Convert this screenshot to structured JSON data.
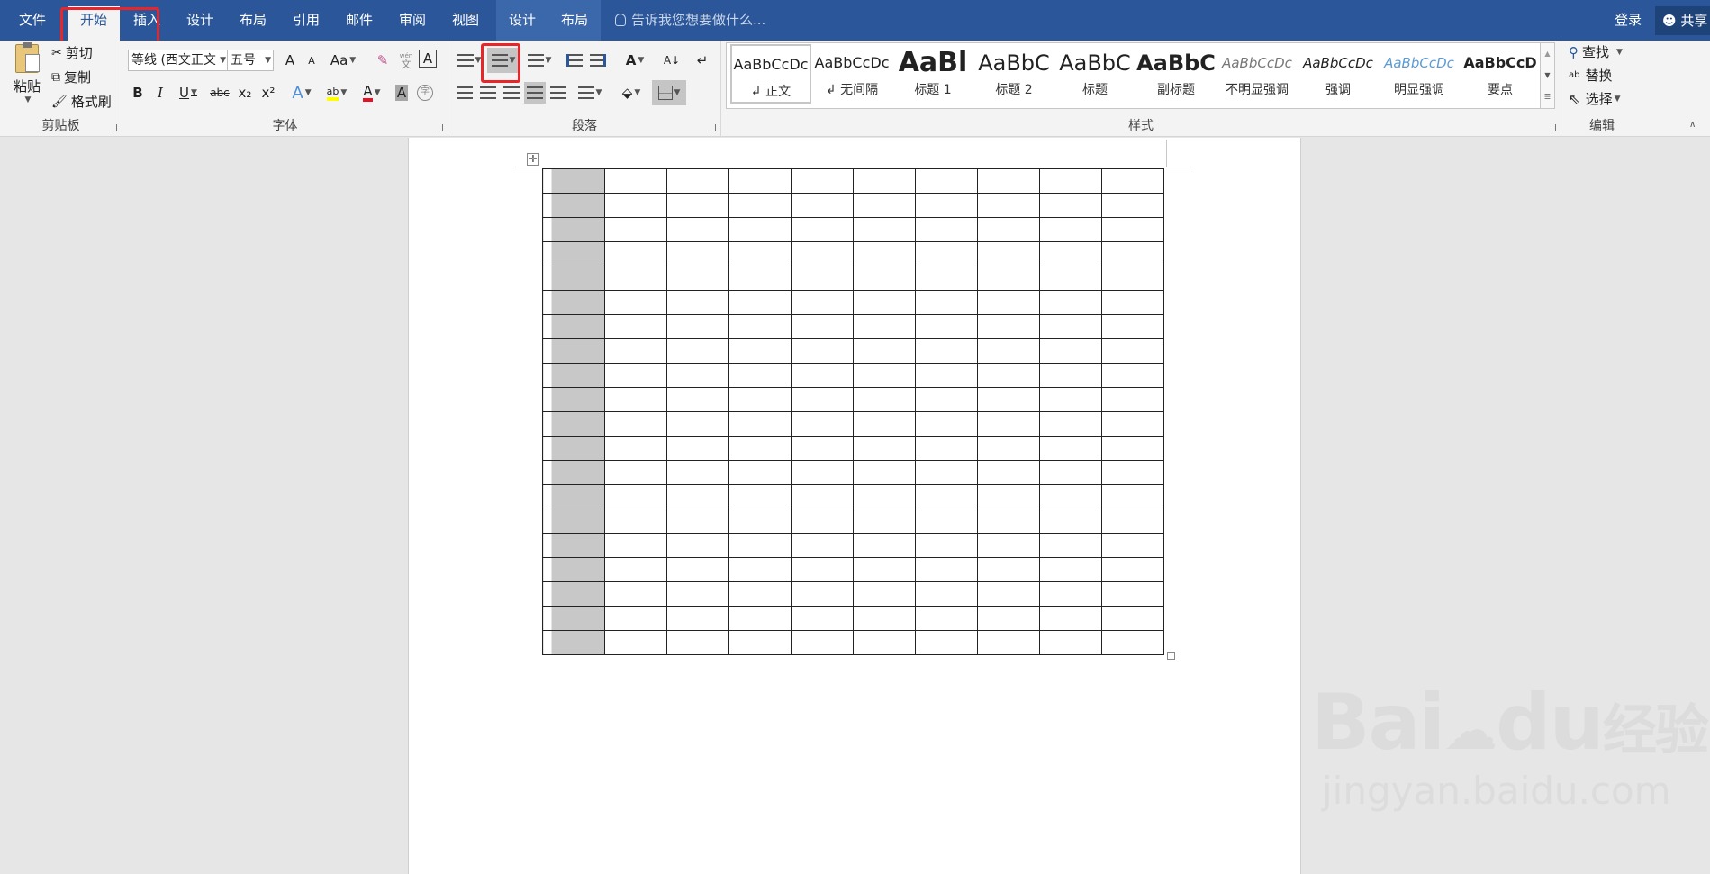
{
  "tabs": [
    "文件",
    "开始",
    "插入",
    "设计",
    "布局",
    "引用",
    "邮件",
    "审阅",
    "视图",
    "设计",
    "布局"
  ],
  "tell_me": "告诉我您想要做什么...",
  "login": "登录",
  "share": "共享",
  "clipboard": {
    "paste": "粘贴",
    "cut": "剪切",
    "copy": "复制",
    "format_painter": "格式刷",
    "label": "剪贴板"
  },
  "font": {
    "name": "等线 (西文正文",
    "size": "五号",
    "label": "字体",
    "grow": "A",
    "shrink": "A",
    "case": "Aa",
    "bold": "B",
    "italic": "I",
    "underline": "U",
    "strike": "abc",
    "sub": "x₂",
    "sup": "x²",
    "effects": "A",
    "highlight": "ab",
    "color": "A",
    "shade": "A",
    "circle": "字",
    "phonetic_top": "wén",
    "phonetic_bottom": "文",
    "border": "A"
  },
  "paragraph": {
    "label": "段落",
    "sort": "A↓"
  },
  "styles": {
    "label": "样式",
    "items": [
      {
        "preview": "AaBbCcDc",
        "name": "↲ 正文"
      },
      {
        "preview": "AaBbCcDc",
        "name": "↲ 无间隔"
      },
      {
        "preview": "AaBl",
        "name": "标题 1"
      },
      {
        "preview": "AaBbC",
        "name": "标题 2"
      },
      {
        "preview": "AaBbC",
        "name": "标题"
      },
      {
        "preview": "AaBbC",
        "name": "副标题"
      },
      {
        "preview": "AaBbCcDc",
        "name": "不明显强调"
      },
      {
        "preview": "AaBbCcDc",
        "name": "强调"
      },
      {
        "preview": "AaBbCcDc",
        "name": "明显强调"
      },
      {
        "preview": "AaBbCcD",
        "name": "要点"
      }
    ]
  },
  "editing": {
    "find": "查找",
    "replace": "替换",
    "select": "选择",
    "label": "编辑"
  },
  "table": {
    "rows": 20,
    "cols": 10
  },
  "watermark": {
    "main": "Bai",
    "du": "du",
    "cn": "经验",
    "url": "jingyan.baidu.com"
  },
  "colors": {
    "accent": "#2b579a",
    "highlight_red": "#e8262a",
    "first_col": "#c8c8c8"
  }
}
